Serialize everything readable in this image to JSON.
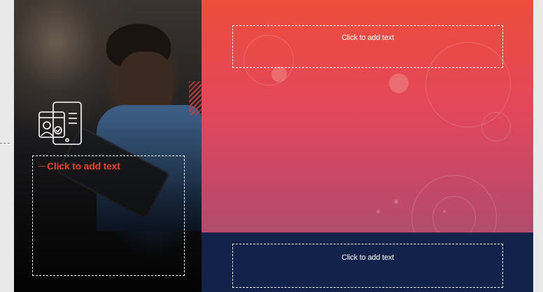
{
  "slide": {
    "title_placeholder": "Click to add text",
    "body_placeholder": "Click to add text",
    "footer_placeholder": "Click to add text"
  },
  "icons": {
    "device": "tablet-id-card-icon"
  },
  "colors": {
    "gradient_top": "#ed4d3a",
    "gradient_bottom": "#b24c6e",
    "navy": "#12224a",
    "accent_text": "#e8452d"
  }
}
